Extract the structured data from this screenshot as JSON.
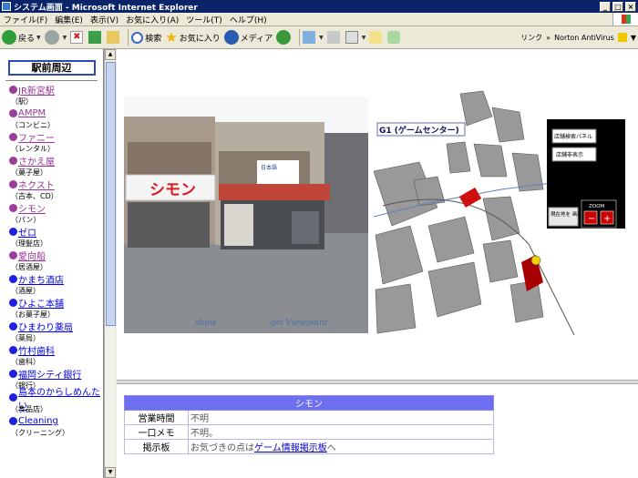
{
  "window": {
    "title": "システム画面 - Microsoft Internet Explorer",
    "controls": [
      "_",
      "□",
      "×"
    ]
  },
  "menu": [
    "ファイル(F)",
    "編集(E)",
    "表示(V)",
    "お気に入り(A)",
    "ツール(T)",
    "ヘルプ(H)"
  ],
  "toolbar": {
    "back": "戻る",
    "search": "検索",
    "favorites": "お気に入り",
    "media": "メディア",
    "links": "リンク",
    "antivirus": "Norton AntiVirus"
  },
  "nav": {
    "title": "駅前周辺",
    "shops": [
      {
        "name": "JR新宮駅",
        "category": "（駅）",
        "visited": true
      },
      {
        "name": "AMPM",
        "category": "（コンビニ）",
        "visited": true
      },
      {
        "name": "ファニー",
        "category": "（レンタル）",
        "visited": true
      },
      {
        "name": "さかえ屋",
        "category": "（菓子屋）",
        "visited": true
      },
      {
        "name": "ネクスト",
        "category": "（古本、CD）",
        "visited": true
      },
      {
        "name": "シモン",
        "category": "（パン）",
        "visited": true
      },
      {
        "name": "ゼロ",
        "category": "（理髪店）",
        "visited": false
      },
      {
        "name": "愛向船",
        "category": "（居酒屋）",
        "visited": true
      },
      {
        "name": "かまち酒店",
        "category": "（酒屋）",
        "visited": false
      },
      {
        "name": "ひよこ本舗",
        "category": "（お菓子屋）",
        "visited": false
      },
      {
        "name": "ひまわり薬局",
        "category": "（薬局）",
        "visited": false
      },
      {
        "name": "竹村歯科",
        "category": "（歯科）",
        "visited": false
      },
      {
        "name": "福岡シティ銀行",
        "category": "（銀行）",
        "visited": false
      },
      {
        "name": "島本のからしめんたい",
        "category": "（食品店）",
        "visited": false
      },
      {
        "name": "Cleaning",
        "category": "（クリーニング）",
        "visited": false
      }
    ]
  },
  "photo": {
    "sign_main": "シモン",
    "sign_side": "日本語",
    "links": [
      "show",
      "get Viewpoint"
    ]
  },
  "map": {
    "location_label": "G1 (ゲームセンター)",
    "buttons": [
      "店舗検索パネル",
      "店舗非表示"
    ],
    "current_location_button": "現在地を\n画面内へ",
    "zoom_label": "ZOOM",
    "zoom_buttons": [
      "−",
      "+"
    ]
  },
  "info": {
    "shop_name": "シモン",
    "rows": [
      {
        "label": "営業時間",
        "value": "不明"
      },
      {
        "label": "一口メモ",
        "value": "不明。"
      },
      {
        "label": "掲示板",
        "prefix": "お気づきの点は",
        "link": "ゲーム情報掲示板",
        "suffix": "へ"
      }
    ]
  },
  "colors": {
    "visited_link": "#993399",
    "unvisited_link": "#0000ee",
    "visited_bullet": "#9b3d9b",
    "unvisited_bullet": "#2020e0",
    "table_header": "#6e6ef0"
  }
}
